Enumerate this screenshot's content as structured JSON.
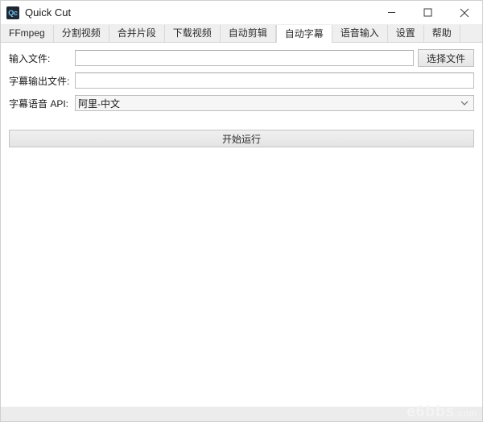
{
  "window": {
    "title": "Quick Cut",
    "icon_label": "Qc",
    "icon_name": "app-icon",
    "controls": [
      {
        "name": "minimize",
        "glyph": "minimize-icon"
      },
      {
        "name": "maximize",
        "glyph": "maximize-icon"
      },
      {
        "name": "close",
        "glyph": "close-icon"
      }
    ]
  },
  "tabs": [
    {
      "label": "FFmpeg",
      "active": false
    },
    {
      "label": "分割视频",
      "active": false
    },
    {
      "label": "合并片段",
      "active": false
    },
    {
      "label": "下载视频",
      "active": false
    },
    {
      "label": "自动剪辑",
      "active": false
    },
    {
      "label": "自动字幕",
      "active": true
    },
    {
      "label": "语音输入",
      "active": false
    },
    {
      "label": "设置",
      "active": false
    },
    {
      "label": "帮助",
      "active": false
    }
  ],
  "form": {
    "input_file": {
      "label": "输入文件:",
      "value": "",
      "placeholder": ""
    },
    "output_file": {
      "label": "字幕输出文件:",
      "value": "",
      "placeholder": ""
    },
    "api": {
      "label": "字幕语音 API:",
      "selected": "阿里-中文",
      "options": [
        "阿里-中文"
      ]
    },
    "choose_file_button": "选择文件"
  },
  "actions": {
    "run_button": "开始运行"
  },
  "watermark": {
    "text": "e6bbs",
    "domain": ".com"
  },
  "colors": {
    "tab_bar_bg": "#efefef",
    "active_tab_bg": "#ffffff",
    "content_bg": "#ffffff",
    "button_bg": "#ececec",
    "border": "#bdbdbd",
    "icon_accent": "#6fc3f0"
  }
}
